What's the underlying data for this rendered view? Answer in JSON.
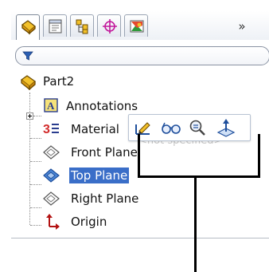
{
  "tabs": [
    {
      "icon": "feature-manager-tree-icon",
      "active": true
    },
    {
      "icon": "property-manager-icon",
      "active": false
    },
    {
      "icon": "configuration-manager-icon",
      "active": false
    },
    {
      "icon": "dimxpert-manager-icon",
      "active": false
    },
    {
      "icon": "display-manager-icon",
      "active": false
    }
  ],
  "more_tabs_glyph": "»",
  "filter": {
    "icon": "filter-funnel-icon"
  },
  "tree": {
    "root_label": "Part2",
    "items": [
      {
        "label": "Annotations",
        "icon": "annotations-icon",
        "expandable": true
      },
      {
        "label": "Material",
        "icon": "material-icon",
        "selected": false
      },
      {
        "label": "Front Plane",
        "icon": "plane-icon",
        "selected": false
      },
      {
        "label": "Top Plane",
        "icon": "plane-icon",
        "selected": true
      },
      {
        "label": "Right Plane",
        "icon": "plane-icon",
        "selected": false
      },
      {
        "label": "Origin",
        "icon": "origin-icon",
        "selected": false
      }
    ],
    "material_ghost": "<not specified>"
  },
  "context_toolbar": {
    "buttons": [
      {
        "name": "edit-sketch-button",
        "icon": "sketch-pencil-icon"
      },
      {
        "name": "hide-show-button",
        "icon": "glasses-icon"
      },
      {
        "name": "zoom-to-selection-button",
        "icon": "zoom-magnifier-icon"
      },
      {
        "name": "normal-to-button",
        "icon": "normal-to-arrow-icon"
      }
    ]
  },
  "colors": {
    "selection": "#3a6ec8",
    "callout": "#000000",
    "toolbar_border": "#b9c4d4"
  }
}
